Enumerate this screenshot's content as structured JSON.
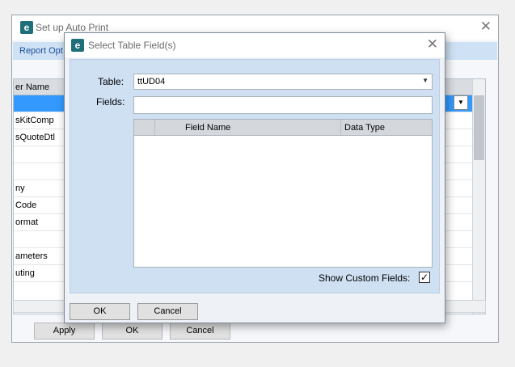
{
  "background_window": {
    "title": "Set up Auto Print",
    "toolbar_text": "Report Opt",
    "grid_header": "er Name",
    "rows": [
      "",
      "sKitComp",
      "sQuoteDtl",
      "",
      "",
      "ny",
      "Code",
      "ormat",
      "",
      "ameters",
      "uting"
    ],
    "buttons": {
      "apply": "Apply",
      "ok": "OK",
      "cancel": "Cancel"
    }
  },
  "dialog": {
    "title": "Select Table Field(s)",
    "table_label": "Table:",
    "table_value": "ttUD04",
    "fields_label": "Fields:",
    "fields_value": "",
    "columns": {
      "field_name": "Field Name",
      "data_type": "Data Type"
    },
    "show_custom_label": "Show Custom Fields:",
    "show_custom_checked": "✓",
    "buttons": {
      "ok": "OK",
      "cancel": "Cancel"
    }
  },
  "icons": {
    "app_icon": "epicor-e-icon",
    "close": "close-icon",
    "dropdown": "chevron-down-icon",
    "sort": "sort-triangle-icon"
  },
  "colors": {
    "accent_panel": "#cfe0f3",
    "selection": "#3399ff",
    "app_icon": "#1f6f7a"
  }
}
